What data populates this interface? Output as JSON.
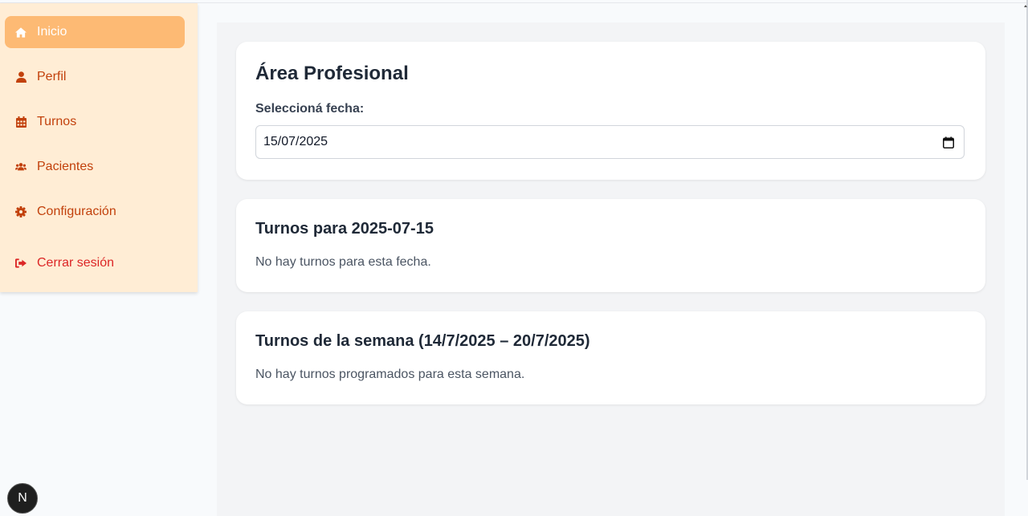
{
  "sidebar": {
    "items": [
      {
        "label": "Inicio",
        "icon": "home-icon",
        "active": true
      },
      {
        "label": "Perfil",
        "icon": "user-icon",
        "active": false
      },
      {
        "label": "Turnos",
        "icon": "calendar-icon",
        "active": false
      },
      {
        "label": "Pacientes",
        "icon": "users-icon",
        "active": false
      },
      {
        "label": "Configuración",
        "icon": "gear-icon",
        "active": false
      }
    ],
    "logout": {
      "label": "Cerrar sesión",
      "icon": "sign-out-icon"
    }
  },
  "main": {
    "title": "Área Profesional",
    "date_label": "Seleccioná fecha:",
    "date_value": "15/07/2025",
    "day_section": {
      "title": "Turnos para 2025-07-15",
      "empty_text": "No hay turnos para esta fecha."
    },
    "week_section": {
      "title": "Turnos de la semana (14/7/2025 – 20/7/2025)",
      "empty_text": "No hay turnos programados para esta semana."
    }
  },
  "dev_badge": {
    "label": "N"
  },
  "colors": {
    "sidebar_bg": "#ffedd5",
    "active_bg": "#fdba74",
    "nav_text": "#c2410c",
    "logout_text": "#dc2626"
  }
}
